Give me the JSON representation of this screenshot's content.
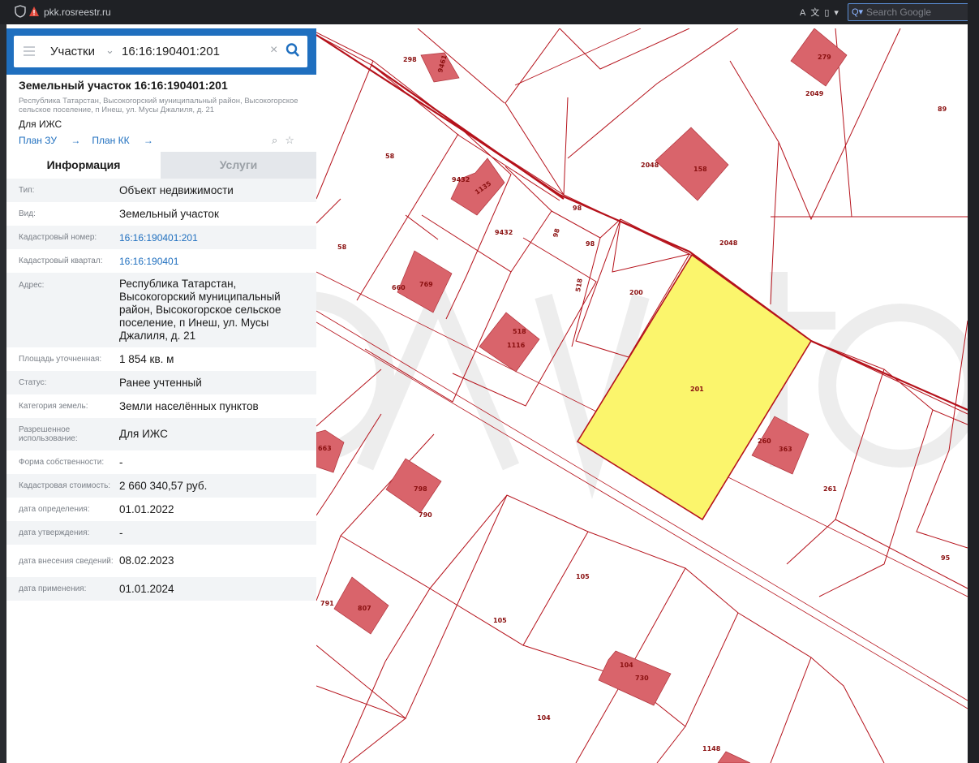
{
  "browser": {
    "url": "pkk.rosreestr.ru",
    "search_placeholder": "Search Google"
  },
  "search": {
    "type": "Участки",
    "query": "16:16:190401:201"
  },
  "parcel": {
    "title": "Земельный участок 16:16:190401:201",
    "address_line": "Республика Татарстан, Высокогорский муниципальный район, Высокогорское сельское поселение, п Инеш, ул. Мусы Джалиля, д. 21",
    "purpose": "Для ИЖС",
    "plan_zu": "План ЗУ",
    "plan_kk": "План КК"
  },
  "tabs": [
    {
      "label": "Информация"
    },
    {
      "label": "Услуги"
    }
  ],
  "info_rows": [
    {
      "key": "Тип:",
      "value": "Объект недвижимости"
    },
    {
      "key": "Вид:",
      "value": "Земельный участок"
    },
    {
      "key": "Кадастровый номер:",
      "value": "16:16:190401:201"
    },
    {
      "key": "Кадастровый квартал:",
      "value": "16:16:190401"
    },
    {
      "key": "Адрес:",
      "value": "Республика Татарстан, Высокогорский муниципальный район, Высокогорское сельское поселение, п Инеш, ул. Мусы Джалиля, д. 21"
    },
    {
      "key": "Площадь уточненная:",
      "value": "1 854 кв. м"
    },
    {
      "key": "Статус:",
      "value": "Ранее учтенный"
    },
    {
      "key": "Категория земель:",
      "value": "Земли населённых пунктов"
    },
    {
      "key": "Разрешенное использование:",
      "value": "Для ИЖС"
    },
    {
      "key": "Форма собственности:",
      "value": "-"
    },
    {
      "key": "Кадастровая стоимость:",
      "value": "2 660 340,57 руб."
    },
    {
      "key": "дата определения:",
      "value": "01.01.2022"
    },
    {
      "key": "дата утверждения:",
      "value": "-"
    },
    {
      "key": "дата внесения сведений:",
      "value": "08.02.2023"
    },
    {
      "key": "дата применения:",
      "value": "01.01.2024"
    }
  ],
  "map": {
    "labels": [
      "298",
      "9461",
      "279",
      "2049",
      "89",
      "58",
      "9432",
      "1135",
      "2048",
      "158",
      "98",
      "9432",
      "98",
      "98",
      "58",
      "2048",
      "660",
      "769",
      "518",
      "200",
      "518",
      "1116",
      "201",
      "663",
      "260",
      "363",
      "798",
      "790",
      "261",
      "95",
      "105",
      "105",
      "791",
      "807",
      "104",
      "730",
      "104",
      "1148"
    ],
    "colors": {
      "boundary": "#b5121b",
      "building": "#d9646b",
      "selected": "#fbf56c"
    }
  }
}
